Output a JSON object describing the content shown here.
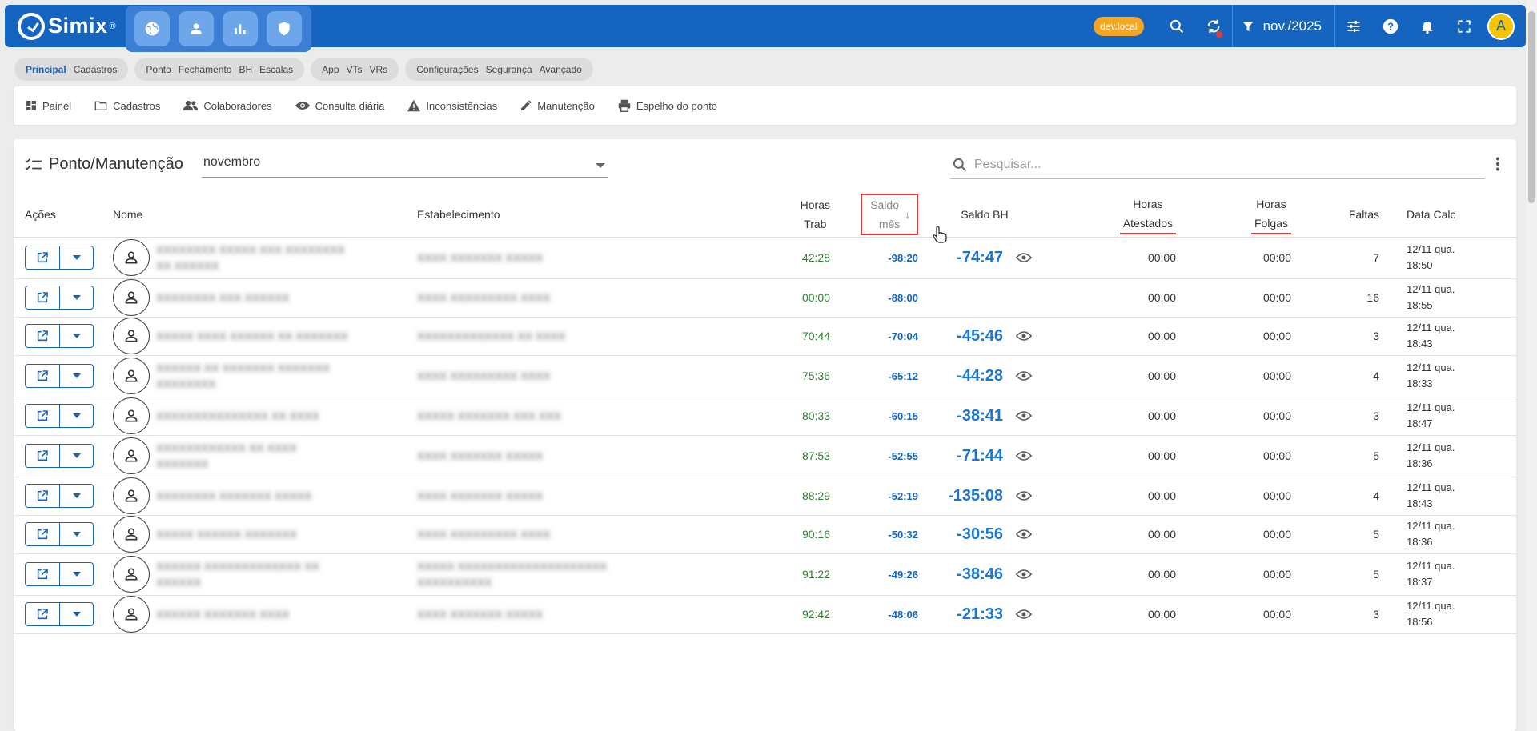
{
  "app": {
    "logo_text": "Simix",
    "logo_reg": "®",
    "env_badge": "dev.local",
    "period": "nov./2025",
    "avatar_letter": "A"
  },
  "chip_groups": [
    [
      "Principal",
      "Cadastros"
    ],
    [
      "Ponto",
      "Fechamento",
      "BH",
      "Escalas"
    ],
    [
      "App",
      "VTs",
      "VRs"
    ],
    [
      "Configurações",
      "Segurança",
      "Avançado"
    ]
  ],
  "nav": [
    "Painel",
    "Cadastros",
    "Colaboradores",
    "Consulta diária",
    "Inconsistências",
    "Manutenção",
    "Espelho do ponto"
  ],
  "page": {
    "title": "Ponto/Manutenção",
    "month": "novembro",
    "search_placeholder": "Pesquisar..."
  },
  "table": {
    "headers": {
      "acoes": "Ações",
      "nome": "Nome",
      "estabelecimento": "Estabelecimento",
      "horas_trab_1": "Horas",
      "horas_trab_2": "Trab",
      "saldo_mes_1": "Saldo",
      "saldo_mes_2": "mês",
      "saldo_bh": "Saldo BH",
      "horas_atest_1": "Horas",
      "horas_atest_2": "Atestados",
      "horas_folgas_1": "Horas",
      "horas_folgas_2": "Folgas",
      "faltas": "Faltas",
      "data_calc": "Data Calc"
    },
    "rows": [
      {
        "nome": "XXXXXXXX XXXXX XXX XXXXXXXX XX XXXXXX",
        "est": "XXXX XXXXXXX XXXXX",
        "ht": "42:28",
        "sm": "-98:20",
        "sbh": "-74:47",
        "ha": "00:00",
        "hf": "00:00",
        "fa": "7",
        "dc1": "12/11 qua.",
        "dc2": "18:50"
      },
      {
        "nome": "XXXXXXXX XXX XXXXXX",
        "est": "XXXX XXXXXXXXX XXXX",
        "ht": "00:00",
        "sm": "-88:00",
        "sbh": "",
        "ha": "00:00",
        "hf": "00:00",
        "fa": "16",
        "dc1": "12/11 qua.",
        "dc2": "18:55"
      },
      {
        "nome": "XXXXX XXXX XXXXXX XX XXXXXXX",
        "est": "XXXXXXXXXXXXX XX XXXX",
        "ht": "70:44",
        "sm": "-70:04",
        "sbh": "-45:46",
        "ha": "00:00",
        "hf": "00:00",
        "fa": "3",
        "dc1": "12/11 qua.",
        "dc2": "18:43"
      },
      {
        "nome": "XXXXXX XX XXXXXXX XXXXXXX XXXXXXXX",
        "est": "XXXX XXXXXXXXX XXXX",
        "ht": "75:36",
        "sm": "-65:12",
        "sbh": "-44:28",
        "ha": "00:00",
        "hf": "00:00",
        "fa": "4",
        "dc1": "12/11 qua.",
        "dc2": "18:33"
      },
      {
        "nome": "XXXXXXXXXXXXXXX XX XXXX",
        "est": "XXXXX XXXXXXX XXX XXX",
        "ht": "80:33",
        "sm": "-60:15",
        "sbh": "-38:41",
        "ha": "00:00",
        "hf": "00:00",
        "fa": "3",
        "dc1": "12/11 qua.",
        "dc2": "18:47"
      },
      {
        "nome": "XXXXXXXXXXXX XX XXXX XXXXXXX",
        "est": "XXXX XXXXXXX XXXXX",
        "ht": "87:53",
        "sm": "-52:55",
        "sbh": "-71:44",
        "ha": "00:00",
        "hf": "00:00",
        "fa": "5",
        "dc1": "12/11 qua.",
        "dc2": "18:36"
      },
      {
        "nome": "XXXXXXXX XXXXXXX XXXXX",
        "est": "XXXX XXXXXXX XXXXX",
        "ht": "88:29",
        "sm": "-52:19",
        "sbh": "-135:08",
        "ha": "00:00",
        "hf": "00:00",
        "fa": "4",
        "dc1": "12/11 qua.",
        "dc2": "18:43"
      },
      {
        "nome": "XXXXX XXXXXX XXXXXXX",
        "est": "XXXX XXXXXXXXX XXXX",
        "ht": "90:16",
        "sm": "-50:32",
        "sbh": "-30:56",
        "ha": "00:00",
        "hf": "00:00",
        "fa": "5",
        "dc1": "12/11 qua.",
        "dc2": "18:36"
      },
      {
        "nome": "XXXXXX XXXXXXXXXXXXX XX XXXXXX",
        "est": "XXXXX XXXXXXXXXXXXXXXXXXXX XXXXXXXXXX",
        "ht": "91:22",
        "sm": "-49:26",
        "sbh": "-38:46",
        "ha": "00:00",
        "hf": "00:00",
        "fa": "5",
        "dc1": "12/11 qua.",
        "dc2": "18:37"
      },
      {
        "nome": "XXXXXX XXXXXXX XXXX",
        "est": "XXXX XXXXXXX XXXXX",
        "ht": "92:42",
        "sm": "-48:06",
        "sbh": "-21:33",
        "ha": "00:00",
        "hf": "00:00",
        "fa": "3",
        "dc1": "12/11 qua.",
        "dc2": "18:56"
      }
    ]
  },
  "colors": {
    "primary": "#1565c0",
    "accent_badge": "#f5a623",
    "positive_hours": "#2e7d32",
    "highlight_red": "#e53935"
  }
}
